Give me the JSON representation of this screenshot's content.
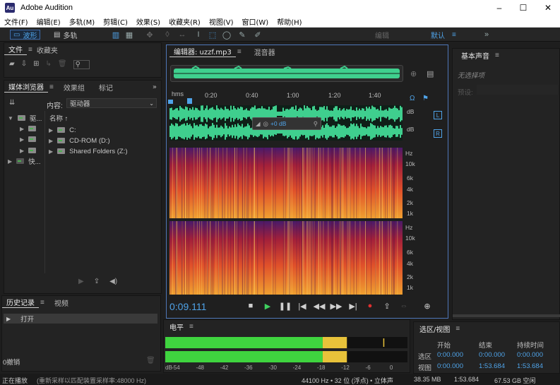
{
  "window": {
    "app_icon": "Au",
    "title": "Adobe Audition",
    "minimize": "–",
    "maximize": "☐",
    "close": "✕"
  },
  "menu": [
    "文件(F)",
    "编辑(E)",
    "多轨(M)",
    "剪辑(C)",
    "效果(S)",
    "收藏夹(R)",
    "视图(V)",
    "窗口(W)",
    "帮助(H)"
  ],
  "toolbar": {
    "waveform": "波形",
    "multitrack": "多轨",
    "workspace_default": "默认",
    "workspace_edit": "编辑"
  },
  "files_panel": {
    "tabs": [
      "文件",
      "收藏夹"
    ]
  },
  "media_browser": {
    "tabs": [
      "媒体浏览器",
      "效果组",
      "标记"
    ],
    "content_label": "内容:",
    "content_value": "驱动器",
    "name_header": "名称",
    "left_tree": [
      "驱...",
      "快..."
    ],
    "drives": [
      "C:",
      "CD-ROM (D:)",
      "Shared Folders (Z:)"
    ]
  },
  "history_panel": {
    "tabs": [
      "历史记录",
      "视频"
    ],
    "items": [
      "打开"
    ],
    "undo_count": "0撤销"
  },
  "editor": {
    "tab_label": "编辑器: uzzf.mp3",
    "mixer_tab": "混音器",
    "ruler_unit": "hms",
    "ruler_ticks": [
      "0:20",
      "0:40",
      "1:00",
      "1:20",
      "1:40"
    ],
    "db_label": "dB",
    "channel_left": "L",
    "channel_right": "R",
    "hz_label": "Hz",
    "hz_ticks": [
      "10k",
      "6k",
      "4k",
      "2k",
      "1k"
    ],
    "gain_value": "+0 dB",
    "current_time": "0:09.111"
  },
  "basic_sound": {
    "title": "基本声音",
    "no_selection": "无选择项",
    "preset_label": "预设:"
  },
  "level_panel": {
    "title": "电平",
    "scale": [
      "dB",
      "-54",
      "-48",
      "-42",
      "-36",
      "-30",
      "-24",
      "-18",
      "-12",
      "-6",
      "0"
    ],
    "left_level_db": -18,
    "right_level_db": -18
  },
  "selection_panel": {
    "title": "选区/视图",
    "headers": [
      "开始",
      "结束",
      "持续时间"
    ],
    "rows": [
      {
        "label": "选区",
        "start": "0:00.000",
        "end": "0:00.000",
        "duration": "0:00.000"
      },
      {
        "label": "视图",
        "start": "0:00.000",
        "end": "1:53.684",
        "duration": "1:53.684"
      }
    ]
  },
  "status": {
    "message": "正在播放",
    "resample": "(重新采样以匹配装置采样率:48000 Hz)",
    "format": "44100 Hz • 32 位 (浮点) • 立体声",
    "file_size": "38.35 MB",
    "duration": "1:53.684",
    "free_space": "67.53 GB 空闲"
  },
  "colors": {
    "accent": "#4f77b8",
    "waveform_green": "#3fcf8e",
    "time_blue": "#4fa3e8",
    "meter_green": "#3fd43f",
    "meter_yellow": "#e8c23a"
  }
}
